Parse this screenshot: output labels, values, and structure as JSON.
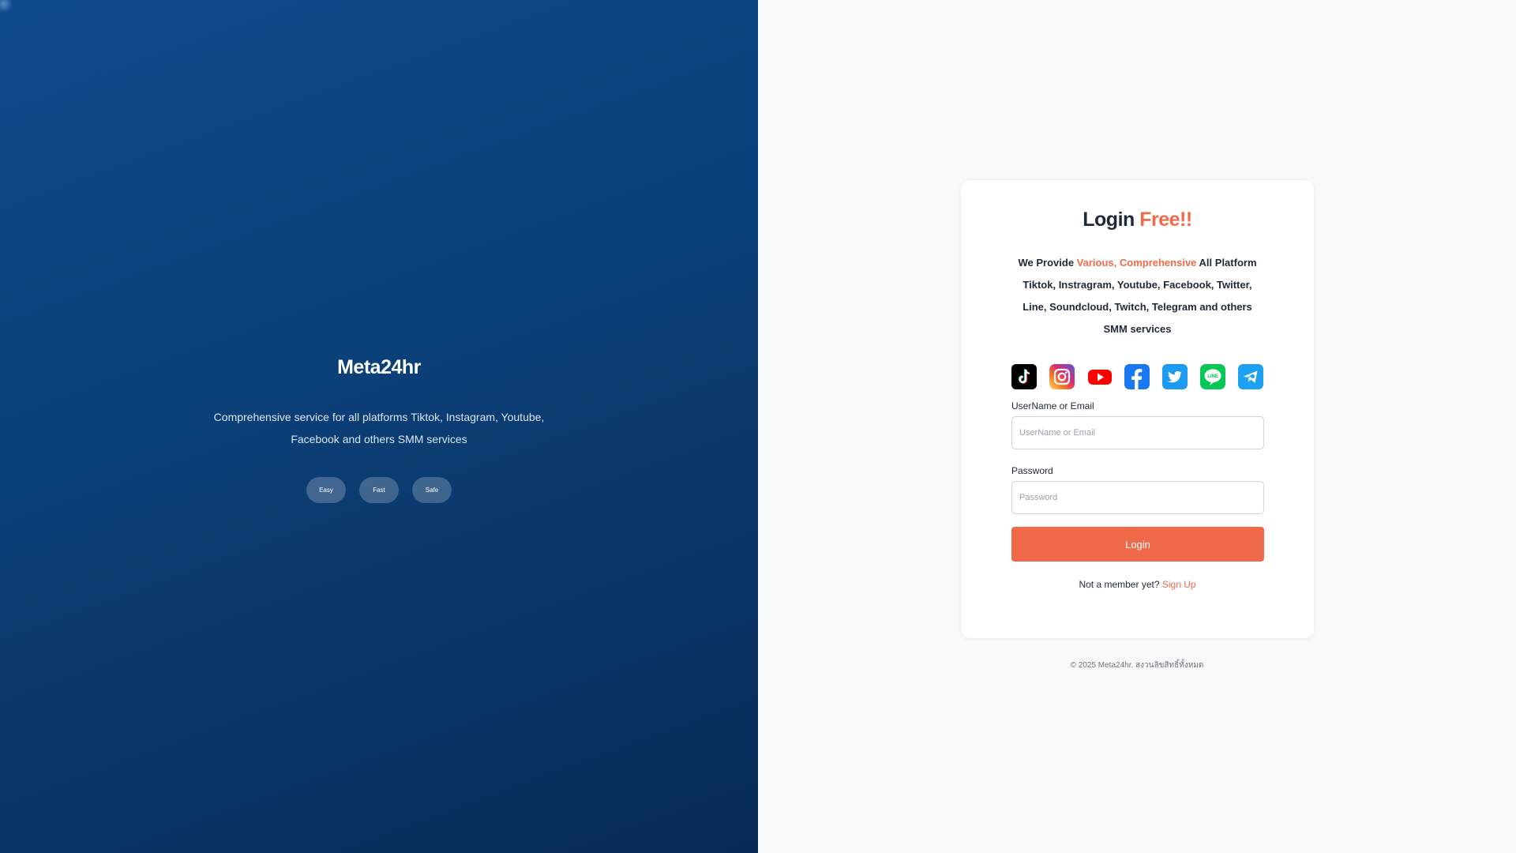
{
  "left_panel": {
    "brand": "Meta24hr",
    "tagline": "Comprehensive service for all platforms Tiktok, Instagram, Youtube, Facebook and others SMM services",
    "pills": [
      {
        "label": "Easy"
      },
      {
        "label": "Fast"
      },
      {
        "label": "Safe"
      }
    ],
    "background_colors": [
      "#0d4a8c",
      "#082b55"
    ]
  },
  "card": {
    "title_main": "Login",
    "title_accent": "Free!!",
    "desc_prefix": "We Provide",
    "desc_accent": "Various, Comprehensive",
    "desc_suffix": "All Platform Tiktok, Instragram, Youtube, Facebook, Twitter, Line, Soundcloud, Twitch, Telegram and others SMM services",
    "platform_icons": [
      {
        "name": "tiktok-icon"
      },
      {
        "name": "instagram-icon"
      },
      {
        "name": "youtube-icon"
      },
      {
        "name": "facebook-icon"
      },
      {
        "name": "twitter-icon"
      },
      {
        "name": "line-icon"
      },
      {
        "name": "telegram-icon"
      }
    ],
    "username": {
      "label": "UserName or Email",
      "placeholder": "UserName or Email",
      "value": ""
    },
    "password": {
      "label": "Password",
      "placeholder": "Password",
      "value": ""
    },
    "login_button": "Login",
    "signup_prompt": "Not a member yet?",
    "signup_link": "Sign Up"
  },
  "footer": {
    "copyright": "© 2025 Meta24hr. สงวนลิขสิทธิ์ทั้งหมด"
  },
  "colors": {
    "accent": "#f06a4a",
    "text_dark": "#1f2937",
    "right_bg": "#f8f9fa"
  }
}
